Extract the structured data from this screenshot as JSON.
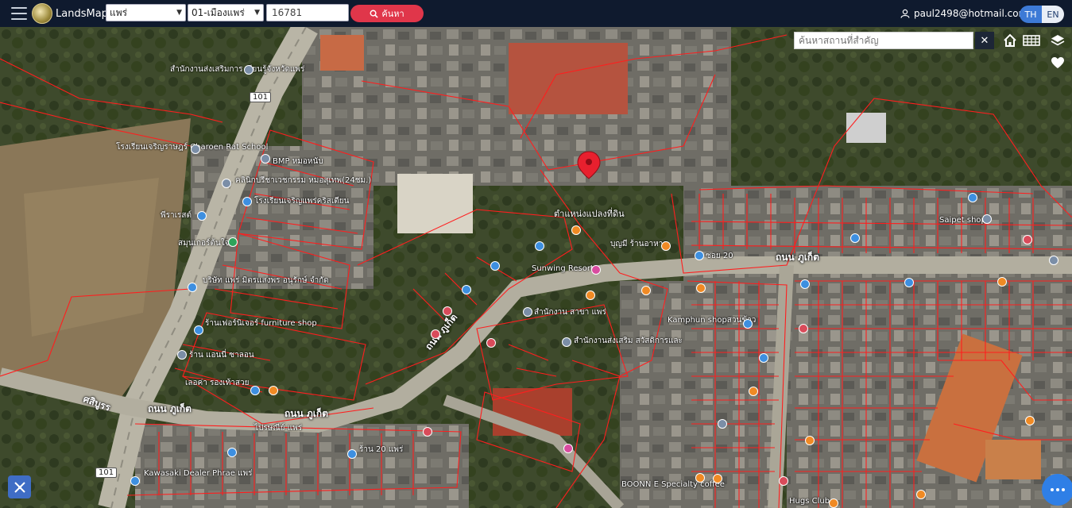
{
  "app": {
    "brand": "LandsMaps"
  },
  "toolbar": {
    "province": "แพร่",
    "district": "01-เมืองแพร่",
    "parcel_number": "16781",
    "search_label": "ค้นหา"
  },
  "user": {
    "email": "paul2498@hotmail.com"
  },
  "language": {
    "th": "TH",
    "en": "EN"
  },
  "map_search": {
    "placeholder": "ค้นหาสถานที่สำคัญ"
  },
  "map": {
    "pin_label": "ตำแหน่งแปลงที่ดิน",
    "roads": {
      "route_101_a": "101",
      "route_101_b": "101",
      "phuket_1": "ถนน ภูเก็ต",
      "phuket_2": "ถนน ภูเก็ต",
      "phuket_3": "ถนน ภูเก็ต",
      "phuket_4": "ถนน ภูเก็ต",
      "sirubon": "ศสิบูรร"
    },
    "places": [
      "สำนักงานส่งเสริมการ เรียนรู้จังหวัดแพร่",
      "โรงเรียนเจริญราษฎร์ Charoen Rat School",
      "BMP หมอหนับ",
      "คลินิกปรีชาเวชกรรม หมอสุเทพ(24ชม.)",
      "โรงเรียนเจริญแพร่คริสเตียน",
      "พีราเรสต์",
      "สมุนเกอร์ต้นใจ",
      "บริษัท แพร่ มิตรแสงพร อนุรักษ์ จำกัด",
      "ร้านเฟอร์นิเจอร์ furniture shop",
      "ร้าน แอนนี่ ซาลอน",
      "เลอค่า รองเท้าสวย",
      "Sunwing Resort",
      "บุญมี ร้านอาหาร",
      "ซอย 20",
      "สำนักงาน สาขา แพร่",
      "สำนักงานส่งเสริม สวัสดิการและ",
      "Kamphun shopสวนข้าว",
      "Saipet shop",
      "ไปรษณีย์ แพร่",
      "ร้าน 20 แพร่",
      "Kawasaki Dealer Phrae แพร่",
      "BOONN E Specialty coffee",
      "Hugs Club"
    ]
  }
}
